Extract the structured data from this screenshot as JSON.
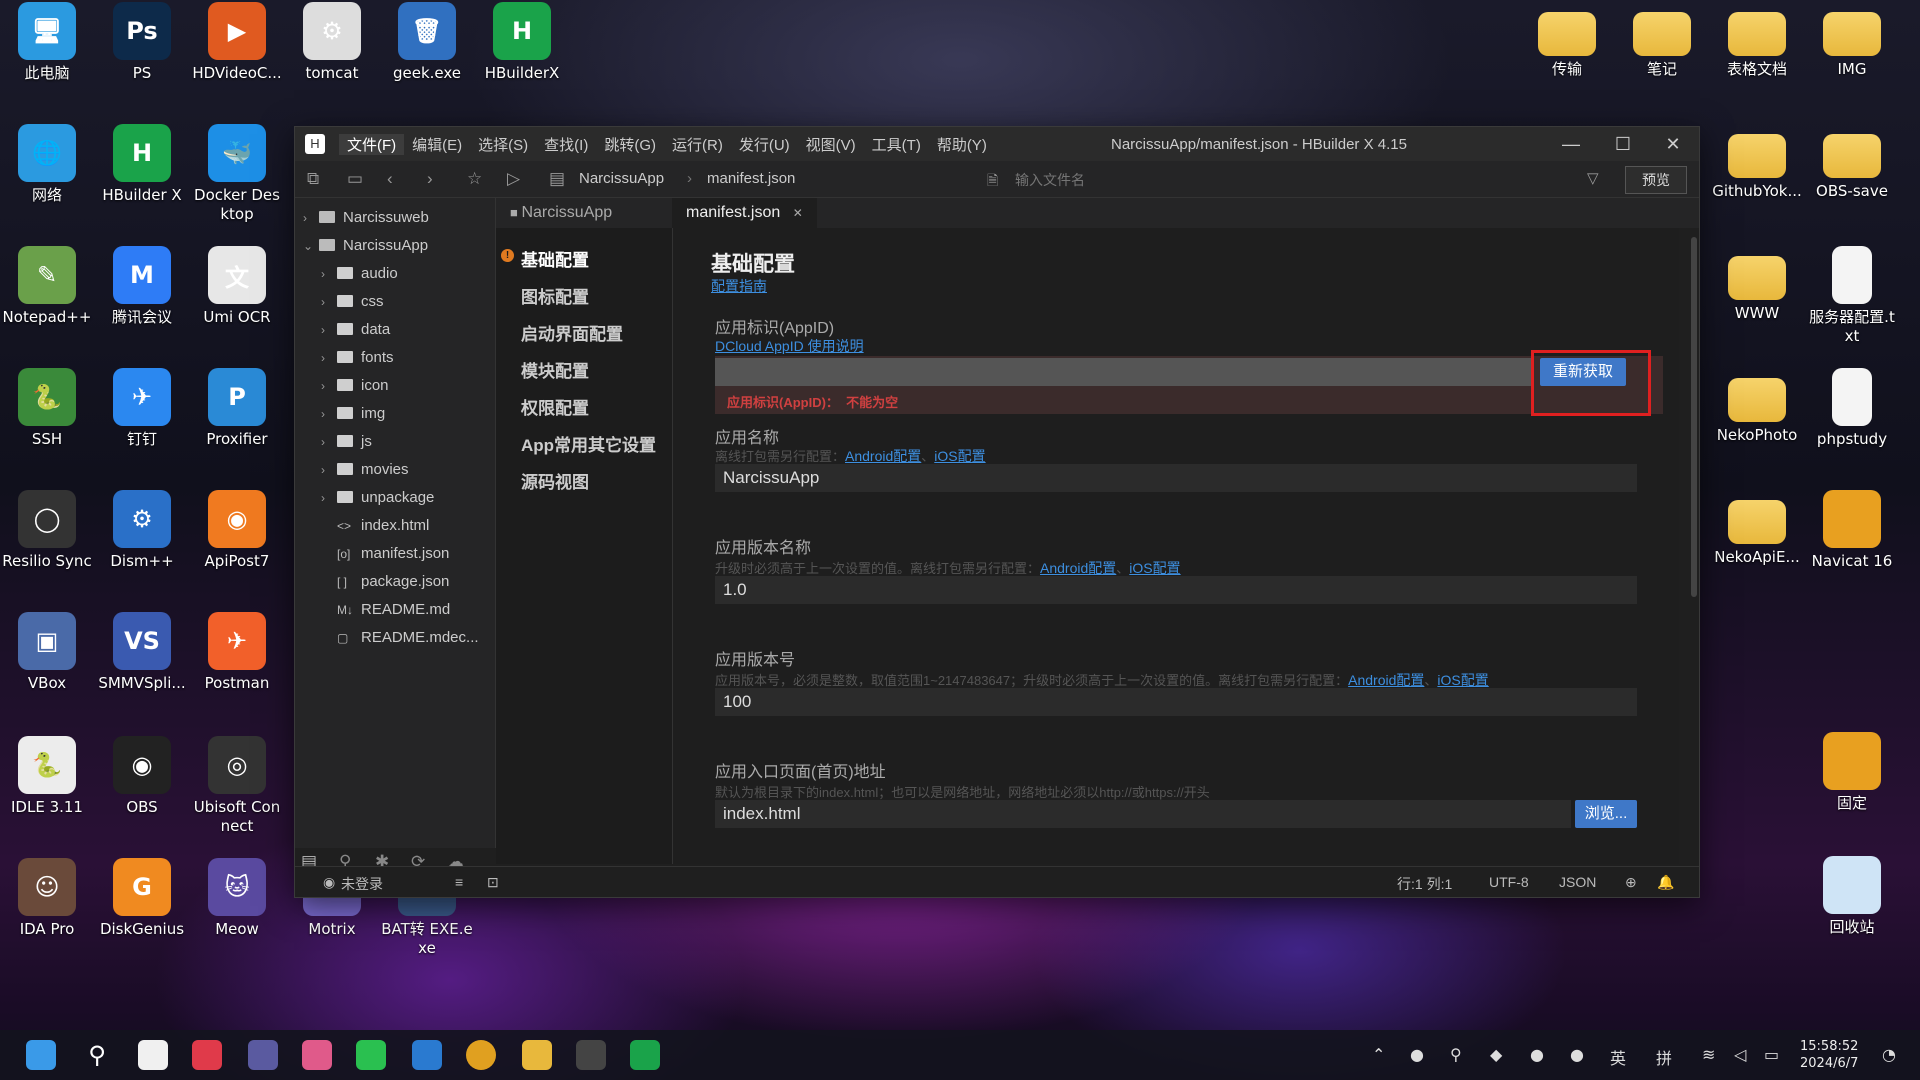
{
  "desktop": {
    "left_icons": [
      {
        "label": "此电脑",
        "color": "#2b9ae0",
        "glyph": "🖥"
      },
      {
        "label": "PS",
        "color": "#0d2a4a",
        "glyph": "Ps"
      },
      {
        "label": "HDVideoC...",
        "color": "#e05a20",
        "glyph": "▶"
      },
      {
        "label": "tomcat",
        "color": "#ddd",
        "glyph": "⚙"
      },
      {
        "label": "geek.exe",
        "color": "#3070c0",
        "glyph": "🗑"
      },
      {
        "label": "HBuilderX",
        "color": "#1aa34a",
        "glyph": "H"
      },
      {
        "label": "网络",
        "color": "#2b9ae0",
        "glyph": "🌐"
      },
      {
        "label": "HBuilder X",
        "color": "#1aa34a",
        "glyph": "H"
      },
      {
        "label": "Docker Desktop",
        "color": "#1d8fe6",
        "glyph": "🐳"
      },
      {
        "label": "Notepad++",
        "color": "#6aa04a",
        "glyph": "✎"
      },
      {
        "label": "腾讯会议",
        "color": "#2e7cf6",
        "glyph": "M"
      },
      {
        "label": "Umi OCR",
        "color": "#e7e7e7",
        "glyph": "文"
      },
      {
        "label": "SSH",
        "color": "#3a8a3a",
        "glyph": "🐍"
      },
      {
        "label": "钉钉",
        "color": "#2b88f0",
        "glyph": "✈"
      },
      {
        "label": "Proxifier",
        "color": "#2a8ad6",
        "glyph": "P"
      },
      {
        "label": "Resilio Sync",
        "color": "#333",
        "glyph": "◯"
      },
      {
        "label": "Dism++",
        "color": "#2a70c8",
        "glyph": "⚙"
      },
      {
        "label": "ApiPost7",
        "color": "#f07a20",
        "glyph": "◉"
      },
      {
        "label": "VBox",
        "color": "#4a6aa8",
        "glyph": "▣"
      },
      {
        "label": "SMMVSpli...",
        "color": "#3a5ab0",
        "glyph": "VS"
      },
      {
        "label": "Postman",
        "color": "#f2602a",
        "glyph": "✈"
      },
      {
        "label": "IDLE 3.11",
        "color": "#ececec",
        "glyph": "🐍"
      },
      {
        "label": "OBS",
        "color": "#222",
        "glyph": "◉"
      },
      {
        "label": "Ubisoft Connect",
        "color": "#333",
        "glyph": "◎"
      },
      {
        "label": "IDA Pro",
        "color": "#6a4a3a",
        "glyph": "☺"
      },
      {
        "label": "DiskGenius",
        "color": "#f08a20",
        "glyph": "G"
      },
      {
        "label": "Meow",
        "color": "#5a4aa0",
        "glyph": "🐱"
      },
      {
        "label": "Motrix",
        "color": "#7a6ad0",
        "glyph": "M"
      },
      {
        "label": "BAT转 EXE.exe",
        "color": "#3a5a8a",
        "glyph": "⚙"
      }
    ],
    "right_icons": [
      {
        "label": "传输",
        "kind": "folder"
      },
      {
        "label": "笔记",
        "kind": "folder"
      },
      {
        "label": "表格文档",
        "kind": "folder"
      },
      {
        "label": "IMG",
        "kind": "folder"
      },
      {
        "label": "GithubYok...",
        "kind": "folder"
      },
      {
        "label": "OBS-save",
        "kind": "folder"
      },
      {
        "label": "WWW",
        "kind": "folder"
      },
      {
        "label": "服务器配置.txt",
        "kind": "file"
      },
      {
        "label": "NekoPhoto",
        "kind": "folder"
      },
      {
        "label": "phpstudy",
        "kind": "file"
      },
      {
        "label": "NekoApiE...",
        "kind": "folder"
      },
      {
        "label": "Navicat 16",
        "kind": "app"
      },
      {
        "label": "固定",
        "kind": "app"
      },
      {
        "label": "回收站",
        "kind": "recycle"
      }
    ]
  },
  "window": {
    "menus": [
      "文件(F)",
      "编辑(E)",
      "选择(S)",
      "查找(I)",
      "跳转(G)",
      "运行(R)",
      "发行(U)",
      "视图(V)",
      "工具(T)",
      "帮助(Y)"
    ],
    "title": "NarcissuApp/manifest.json - HBuilder X 4.15",
    "breadcrumb": [
      "NarcissuApp",
      "manifest.json"
    ],
    "file_search_placeholder": "输入文件名",
    "preview_label": "预览",
    "tree": [
      {
        "label": "Narcissuweb",
        "type": "project",
        "depth": 0,
        "open": false
      },
      {
        "label": "NarcissuApp",
        "type": "project",
        "depth": 0,
        "open": true
      },
      {
        "label": "audio",
        "type": "folder",
        "depth": 1
      },
      {
        "label": "css",
        "type": "folder",
        "depth": 1
      },
      {
        "label": "data",
        "type": "folder",
        "depth": 1
      },
      {
        "label": "fonts",
        "type": "folder",
        "depth": 1
      },
      {
        "label": "icon",
        "type": "folder",
        "depth": 1
      },
      {
        "label": "img",
        "type": "folder",
        "depth": 1
      },
      {
        "label": "js",
        "type": "folder",
        "depth": 1
      },
      {
        "label": "movies",
        "type": "folder",
        "depth": 1
      },
      {
        "label": "unpackage",
        "type": "folder",
        "depth": 1
      },
      {
        "label": "index.html",
        "type": "file",
        "depth": 1,
        "glyph": "<>"
      },
      {
        "label": "manifest.json",
        "type": "file",
        "depth": 1,
        "glyph": "[o]"
      },
      {
        "label": "package.json",
        "type": "file",
        "depth": 1,
        "glyph": "[ ]"
      },
      {
        "label": "README.md",
        "type": "file",
        "depth": 1,
        "glyph": "M↓"
      },
      {
        "label": "README.mdec...",
        "type": "file",
        "depth": 1,
        "glyph": "▢"
      }
    ],
    "tabs": [
      "NarcissuApp",
      "manifest.json"
    ],
    "settings_nav": [
      "基础配置",
      "图标配置",
      "启动界面配置",
      "模块配置",
      "权限配置",
      "App常用其它设置",
      "源码视图"
    ],
    "content": {
      "title": "基础配置",
      "guide_link": "配置指南",
      "appid": {
        "label": "应用标识(AppID)",
        "link": "DCloud AppID 使用说明",
        "value": "",
        "button": "重新获取",
        "error_prefix": "应用标识(AppID)：",
        "error_msg": "不能为空"
      },
      "appname": {
        "label": "应用名称",
        "hint": "离线打包需另行配置：",
        "link_android": "Android配置",
        "sep": "、",
        "link_ios": "iOS配置",
        "value": "NarcissuApp"
      },
      "version_name": {
        "label": "应用版本名称",
        "hint": "升级时必须高于上一次设置的值。离线打包需另行配置：",
        "link_android": "Android配置",
        "sep": "、",
        "link_ios": "iOS配置",
        "value": "1.0"
      },
      "version_code": {
        "label": "应用版本号",
        "hint": "应用版本号，必须是整数，取值范围1~2147483647；升级时必须高于上一次设置的值。离线打包需另行配置：",
        "link_android": "Android配置",
        "sep": "、",
        "link_ios": "iOS配置",
        "value": "100"
      },
      "entry": {
        "label": "应用入口页面(首页)地址",
        "hint": "默认为根目录下的index.html；也可以是网络地址，网络地址必须以http://或https://开头",
        "value": "index.html",
        "button": "浏览..."
      }
    },
    "status": {
      "login": "未登录",
      "position": "行:1  列:1",
      "encoding": "UTF-8",
      "lang": "JSON"
    }
  },
  "taskbar": {
    "lang1": "英",
    "lang2": "拼",
    "time": "15:58:52",
    "date": "2024/6/7"
  },
  "colors": {
    "accent": "#3f78c8",
    "link": "#3d8fe0",
    "error": "#d04040",
    "highlight_box": "#e02020"
  }
}
